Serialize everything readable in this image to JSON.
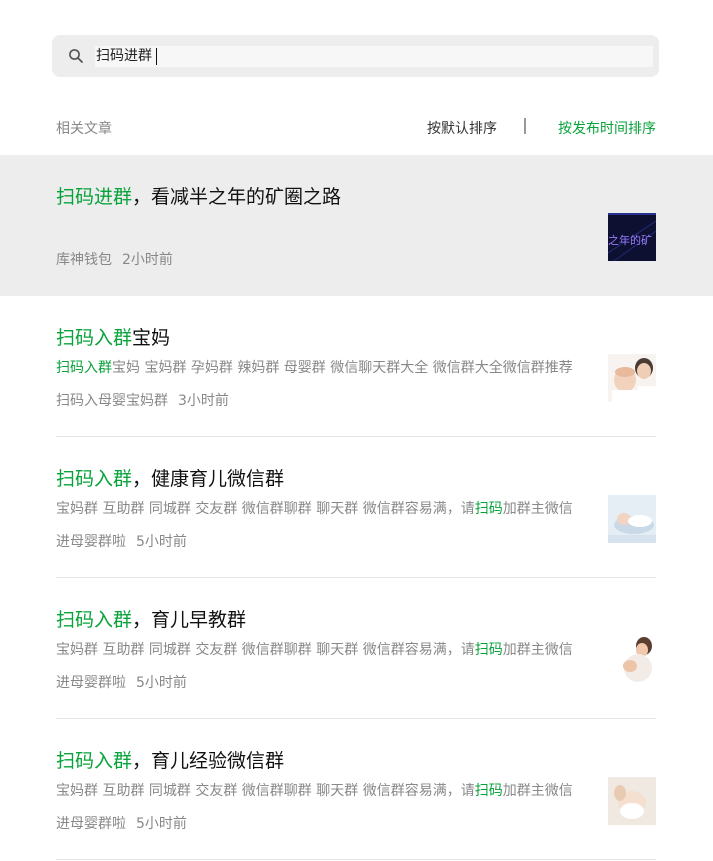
{
  "search": {
    "value": "扫码进群",
    "icon": "search-icon"
  },
  "filter": {
    "label": "相关文章",
    "sort_default": "按默认排序",
    "sort_time": "按发布时间排序",
    "active_color": "#07a33a"
  },
  "results": [
    {
      "title_hl": "扫码进群",
      "title_rest": "，看减半之年的矿圈之路",
      "desc_pre": "",
      "desc_hl": "",
      "desc_post": "",
      "source": "库神钱包",
      "time": "2小时前",
      "thumb_text": "之年的矿"
    },
    {
      "title_hl": "扫码入群",
      "title_rest": "宝妈",
      "desc_pre": "",
      "desc_hl": "扫码入群",
      "desc_post": "宝妈 宝妈群 孕妈群 辣妈群 母婴群 微信聊天群大全 微信群大全微信群推荐",
      "source": "扫码入母婴宝妈群",
      "time": "3小时前"
    },
    {
      "title_hl": "扫码入群",
      "title_rest": "，健康育儿微信群",
      "desc_pre": "宝妈群 互助群 同城群 交友群 微信群聊群 聊天群 微信群容易满，请",
      "desc_hl": "扫码",
      "desc_post": "加群主微信",
      "source": "进母婴群啦",
      "time": "5小时前"
    },
    {
      "title_hl": "扫码入群",
      "title_rest": "，育儿早教群",
      "desc_pre": "宝妈群 互助群 同城群 交友群 微信群聊群 聊天群 微信群容易满，请",
      "desc_hl": "扫码",
      "desc_post": "加群主微信",
      "source": "进母婴群啦",
      "time": "5小时前"
    },
    {
      "title_hl": "扫码入群",
      "title_rest": "，育儿经验微信群",
      "desc_pre": "宝妈群 互助群 同城群 交友群 微信群聊群 聊天群 微信群容易满，请",
      "desc_hl": "扫码",
      "desc_post": "加群主微信",
      "source": "进母婴群啦",
      "time": "5小时前"
    }
  ]
}
